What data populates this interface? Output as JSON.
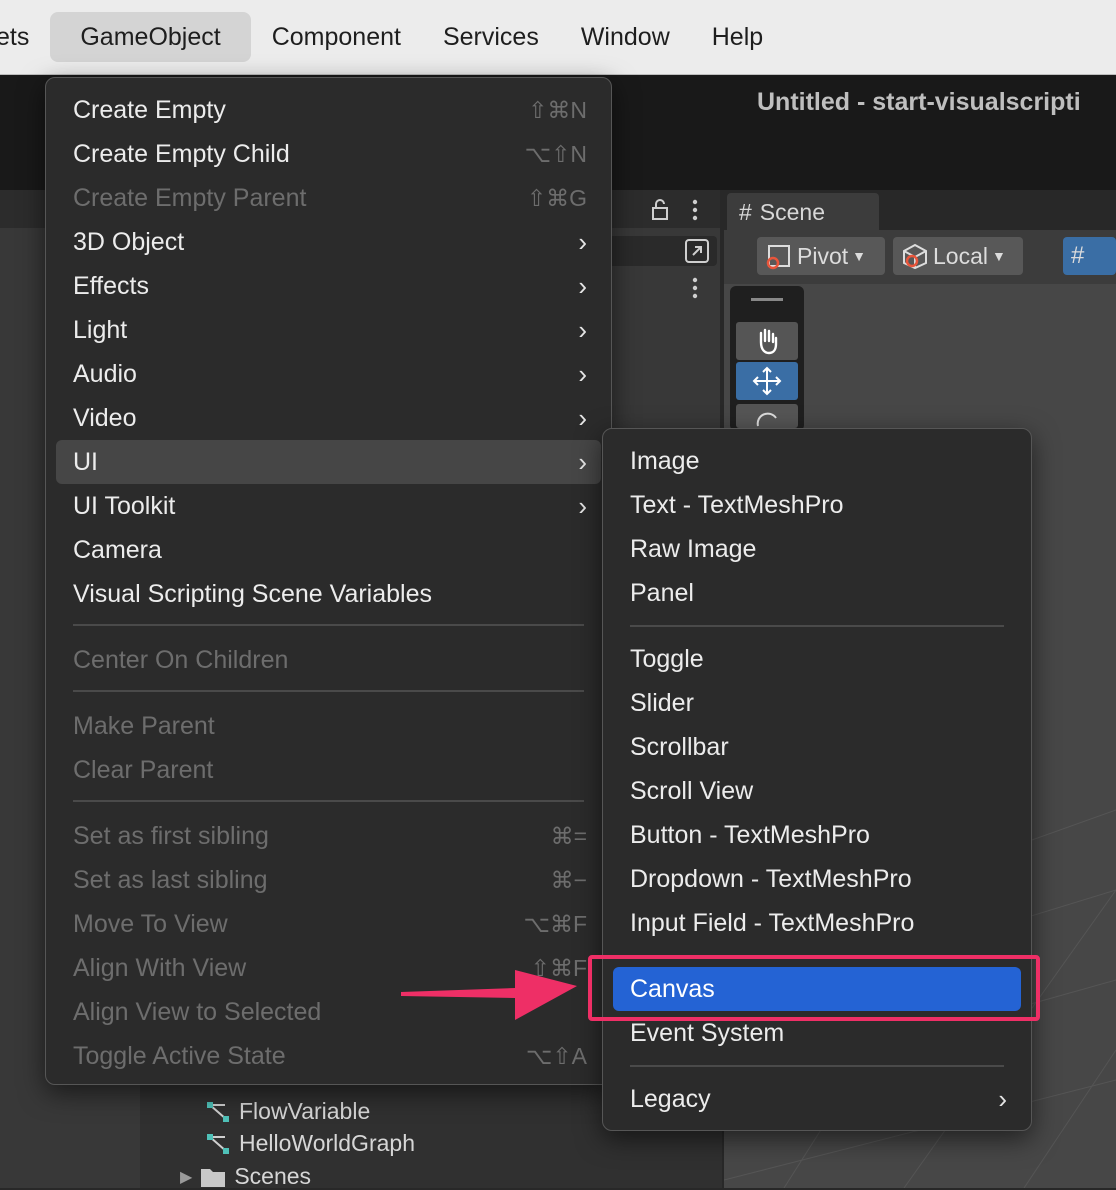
{
  "menubar": {
    "items": [
      "ets",
      "GameObject",
      "Component",
      "Services",
      "Window",
      "Help"
    ]
  },
  "window": {
    "title": "Untitled - start-visualscripti"
  },
  "scene": {
    "tab_label": "Scene",
    "pivot_label": "Pivot",
    "local_label": "Local"
  },
  "gameobject_menu": {
    "items": [
      {
        "label": "Create Empty",
        "shortcut": "⇧⌘N"
      },
      {
        "label": "Create Empty Child",
        "shortcut": "⌥⇧N"
      },
      {
        "label": "Create Empty Parent",
        "shortcut": "⇧⌘G"
      },
      {
        "label": "3D Object",
        "submenu": true
      },
      {
        "label": "Effects",
        "submenu": true
      },
      {
        "label": "Light",
        "submenu": true
      },
      {
        "label": "Audio",
        "submenu": true
      },
      {
        "label": "Video",
        "submenu": true
      },
      {
        "label": "UI",
        "submenu": true
      },
      {
        "label": "UI Toolkit",
        "submenu": true
      },
      {
        "label": "Camera"
      },
      {
        "label": "Visual Scripting Scene Variables"
      },
      {
        "label": "Center On Children"
      },
      {
        "label": "Make Parent"
      },
      {
        "label": "Clear Parent"
      },
      {
        "label": "Set as first sibling",
        "shortcut": "⌘="
      },
      {
        "label": "Set as last sibling",
        "shortcut": "⌘−"
      },
      {
        "label": "Move To View",
        "shortcut": "⌥⌘F"
      },
      {
        "label": "Align With View",
        "shortcut": "⇧⌘F"
      },
      {
        "label": "Align View to Selected"
      },
      {
        "label": "Toggle Active State",
        "shortcut": "⌥⇧A"
      }
    ]
  },
  "ui_submenu": {
    "items": [
      "Image",
      "Text - TextMeshPro",
      "Raw Image",
      "Panel",
      "Toggle",
      "Slider",
      "Scrollbar",
      "Scroll View",
      "Button - TextMeshPro",
      "Dropdown - TextMeshPro",
      "Input Field - TextMeshPro",
      "Canvas",
      "Event System",
      "Legacy"
    ],
    "selected": "Canvas"
  },
  "project_tree": {
    "items": [
      "FlowVariable",
      "HelloWorldGraph",
      "Scenes"
    ]
  },
  "colors": {
    "selection": "#2463d4",
    "annotation": "#ee2f66",
    "menu_bg": "#2b2b2b"
  }
}
